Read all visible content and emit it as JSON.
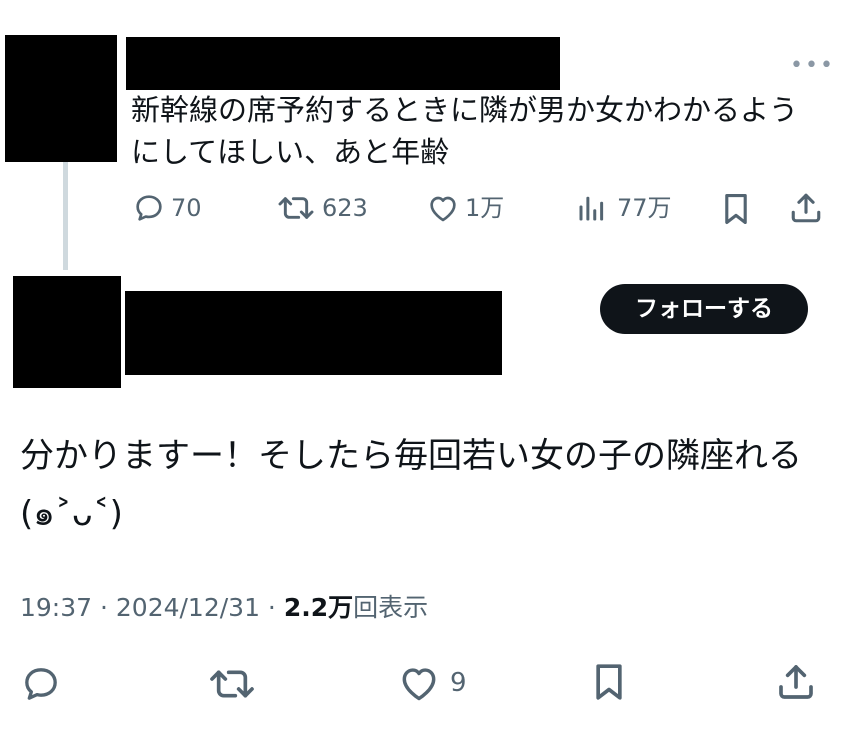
{
  "parent_tweet": {
    "text": "新幹線の席予約するときに隣が男か女かわかるようにしてほしい、あと年齢",
    "more_icon": "more-dots-icon",
    "actions": {
      "reply_count": "70",
      "retweet_count": "623",
      "like_count": "1万",
      "views_count": "77万"
    }
  },
  "reply_tweet": {
    "follow_label": "フォローする",
    "text_line1": "分かりますー！そしたら毎回若い女の子の隣座れる",
    "text_line2": "(๑˃ᴗ˂)",
    "time": "19:37",
    "sep1": " · ",
    "date": "2024/12/31",
    "sep2": " · ",
    "views_count": "2.2万",
    "views_label": "回表示",
    "actions": {
      "like_count": "9"
    }
  },
  "colors": {
    "text": "#0f1419",
    "secondary": "#536471",
    "thread_line": "#cfd9de",
    "follow_bg": "#0f1419"
  }
}
